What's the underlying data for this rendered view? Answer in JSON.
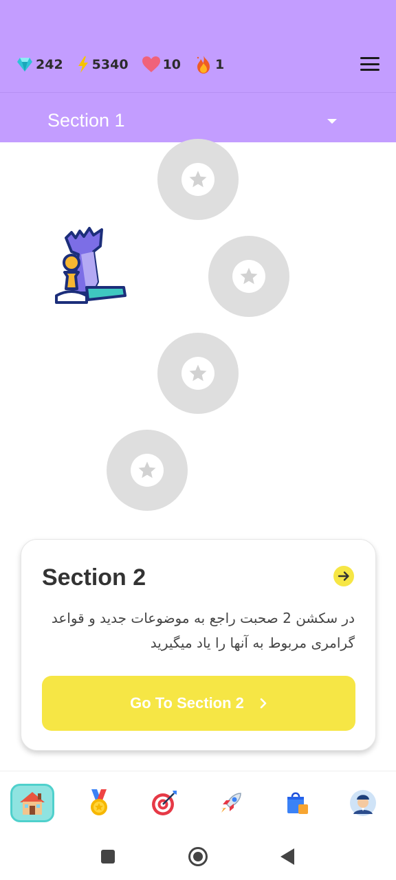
{
  "stats": {
    "gems": "242",
    "energy": "5340",
    "hearts": "10",
    "streak": "1"
  },
  "header": {
    "section_selected": "Section 1"
  },
  "path": {
    "nodes": [
      {
        "state": "locked",
        "icon": "star-icon"
      },
      {
        "state": "locked",
        "icon": "star-icon"
      },
      {
        "state": "locked",
        "icon": "star-icon"
      },
      {
        "state": "locked",
        "icon": "star-icon"
      }
    ],
    "illustration": "chess-pieces-icon"
  },
  "card": {
    "title": "Section 2",
    "description": "در سکشن 2 صحبت راجع به موضوعات جدید و قواعد گرامری مربوط به آنها را یاد میگیرید",
    "button_label": "Go To Section 2"
  },
  "bottom_nav": {
    "items": [
      {
        "icon": "home-icon",
        "active": true
      },
      {
        "icon": "medal-icon",
        "active": false
      },
      {
        "icon": "target-icon",
        "active": false
      },
      {
        "icon": "rocket-icon",
        "active": false
      },
      {
        "icon": "shop-icon",
        "active": false
      },
      {
        "icon": "profile-icon",
        "active": false
      }
    ]
  },
  "colors": {
    "header_bg": "#c39dff",
    "accent_yellow": "#f6e645",
    "node_gray": "#dedede",
    "active_nav": "#8fe3e0"
  }
}
